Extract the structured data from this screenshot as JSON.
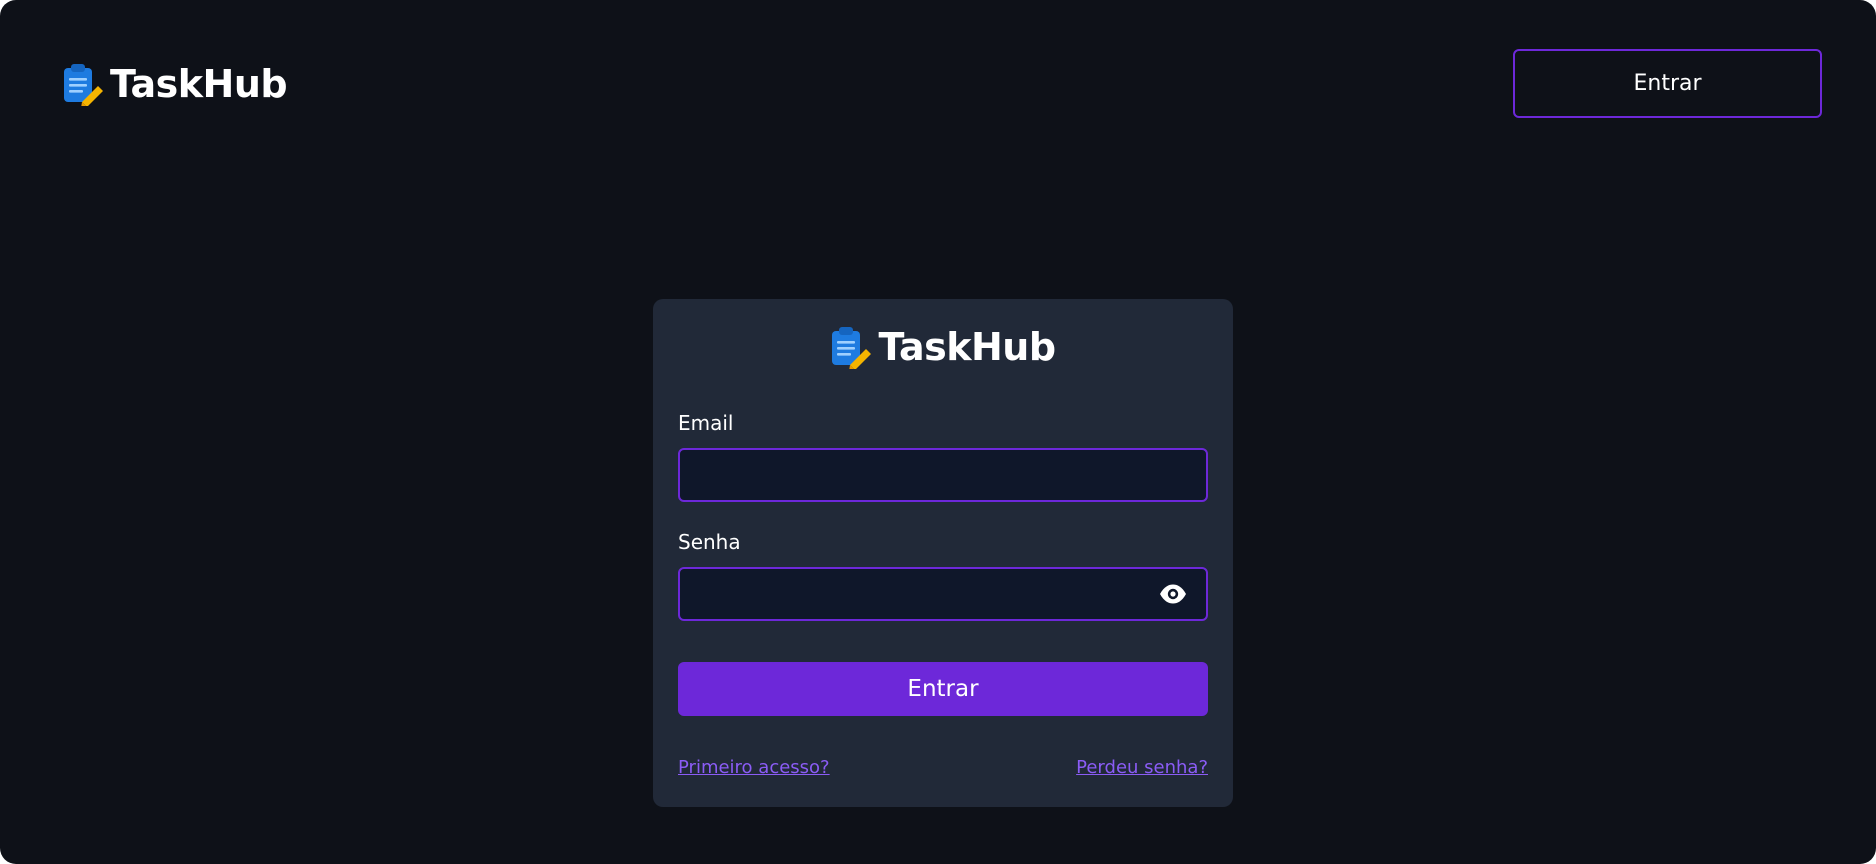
{
  "header": {
    "brand_name": "TaskHub",
    "login_button_label": "Entrar"
  },
  "login_card": {
    "brand_name": "TaskHub",
    "email_label": "Email",
    "email_value": "",
    "password_label": "Senha",
    "password_value": "",
    "submit_label": "Entrar",
    "first_access_link": "Primeiro acesso?",
    "lost_password_link": "Perdeu senha?"
  },
  "icons": {
    "logo": "clipboard-pencil-icon",
    "password_toggle": "eye-icon"
  },
  "colors": {
    "background": "#0e1118",
    "card": "#212938",
    "input_background": "#0f172a",
    "accent": "#6d28d9",
    "link": "#8b5cf6",
    "text": "#ffffff"
  }
}
